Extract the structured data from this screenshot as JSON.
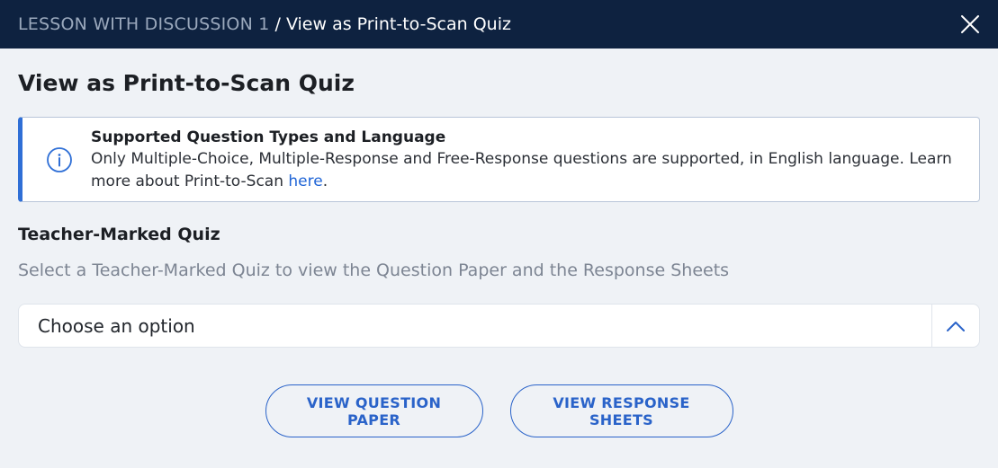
{
  "header": {
    "parent": "LESSON WITH DISCUSSION 1",
    "separator": "/",
    "current": "View as Print-to-Scan Quiz",
    "close_icon": "close-icon",
    "background": "#0e2240"
  },
  "page": {
    "title": "View as Print-to-Scan Quiz"
  },
  "alert": {
    "icon": "info-icon",
    "title": "Supported Question Types and Language",
    "body": "Only Multiple-Choice, Multiple-Response and Free-Response questions are supported, in English language. Learn more about Print-to-Scan ",
    "link_text": "here",
    "trailing": ".",
    "accent": "#2f6fd6"
  },
  "quiz_section": {
    "title": "Teacher-Marked Quiz",
    "description": "Select a Teacher-Marked Quiz to view the Question Paper and the Response Sheets"
  },
  "select": {
    "value": "Choose an option",
    "toggle_icon": "chevron-up-icon"
  },
  "actions": {
    "view_question_paper": "VIEW QUESTION PAPER",
    "view_response_sheets": "VIEW RESPONSE SHEETS",
    "accent": "#2a63c9"
  }
}
